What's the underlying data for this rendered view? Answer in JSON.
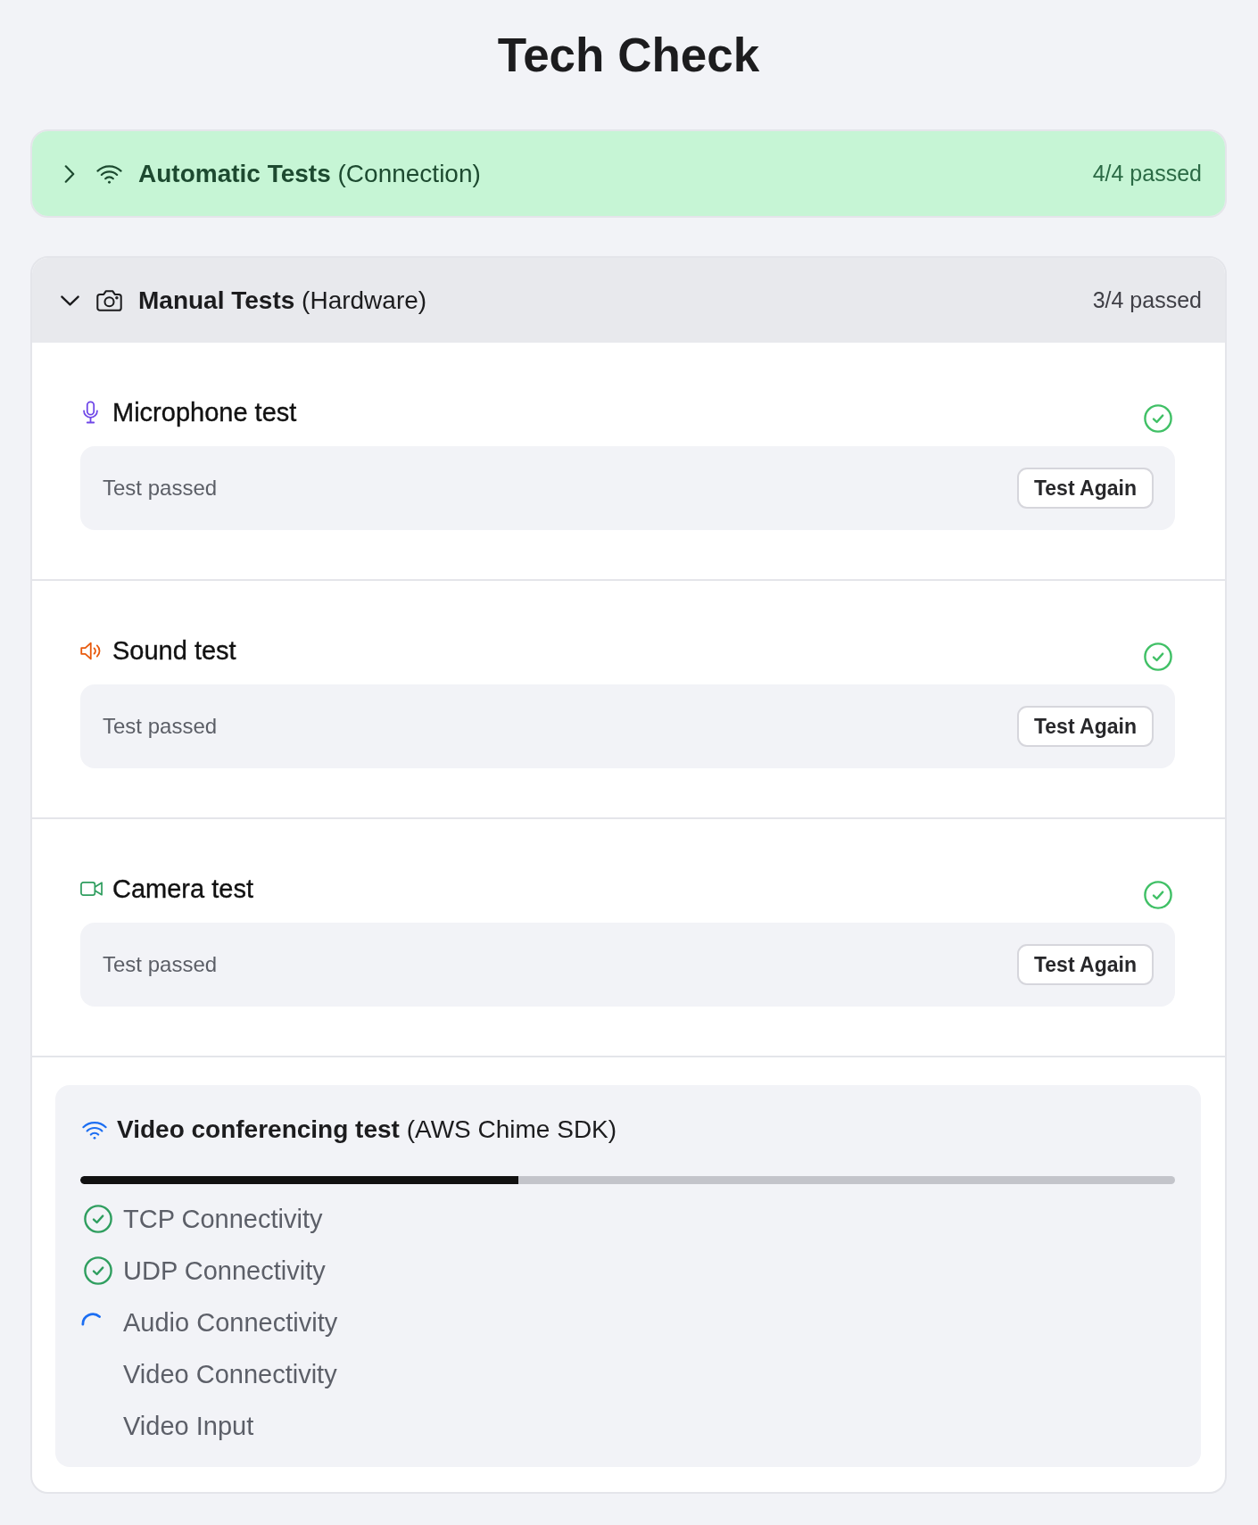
{
  "title": "Tech Check",
  "sections": [
    {
      "kind": "connection",
      "title": "**Automatic Tests** (Connection)",
      "summary": "4/4 passed",
      "all_passed": true,
      "expanded": false
    },
    {
      "kind": "hardware",
      "title": "**Manual Tests** (Hardware)",
      "summary": "3/4 passed",
      "all_passed": false,
      "expanded": true,
      "tests": [
        {
          "kind": "microphone",
          "title": "Microphone test",
          "passed": true,
          "message": "Test passed",
          "button": "Test Again"
        },
        {
          "kind": "speaker",
          "title": "Sound test",
          "passed": true,
          "message": "Test passed",
          "button": "Test Again"
        },
        {
          "kind": "camera",
          "title": "Camera test",
          "passed": true,
          "message": "Test passed",
          "button": "Test Again"
        }
      ],
      "video_test": {
        "title": "**Video conferencing test** (AWS Chime SDK)",
        "level": 0.4,
        "steps": [
          {
            "label": "TCP Connectivity",
            "passed": true,
            "running": false
          },
          {
            "label": "UDP Connectivity",
            "passed": true,
            "running": false
          },
          {
            "label": "Audio Connectivity",
            "passed": false,
            "running": true
          },
          {
            "label": "Video Connectivity",
            "passed": false,
            "running": false
          },
          {
            "label": "Video Input",
            "passed": false,
            "running": false
          }
        ]
      }
    }
  ]
}
